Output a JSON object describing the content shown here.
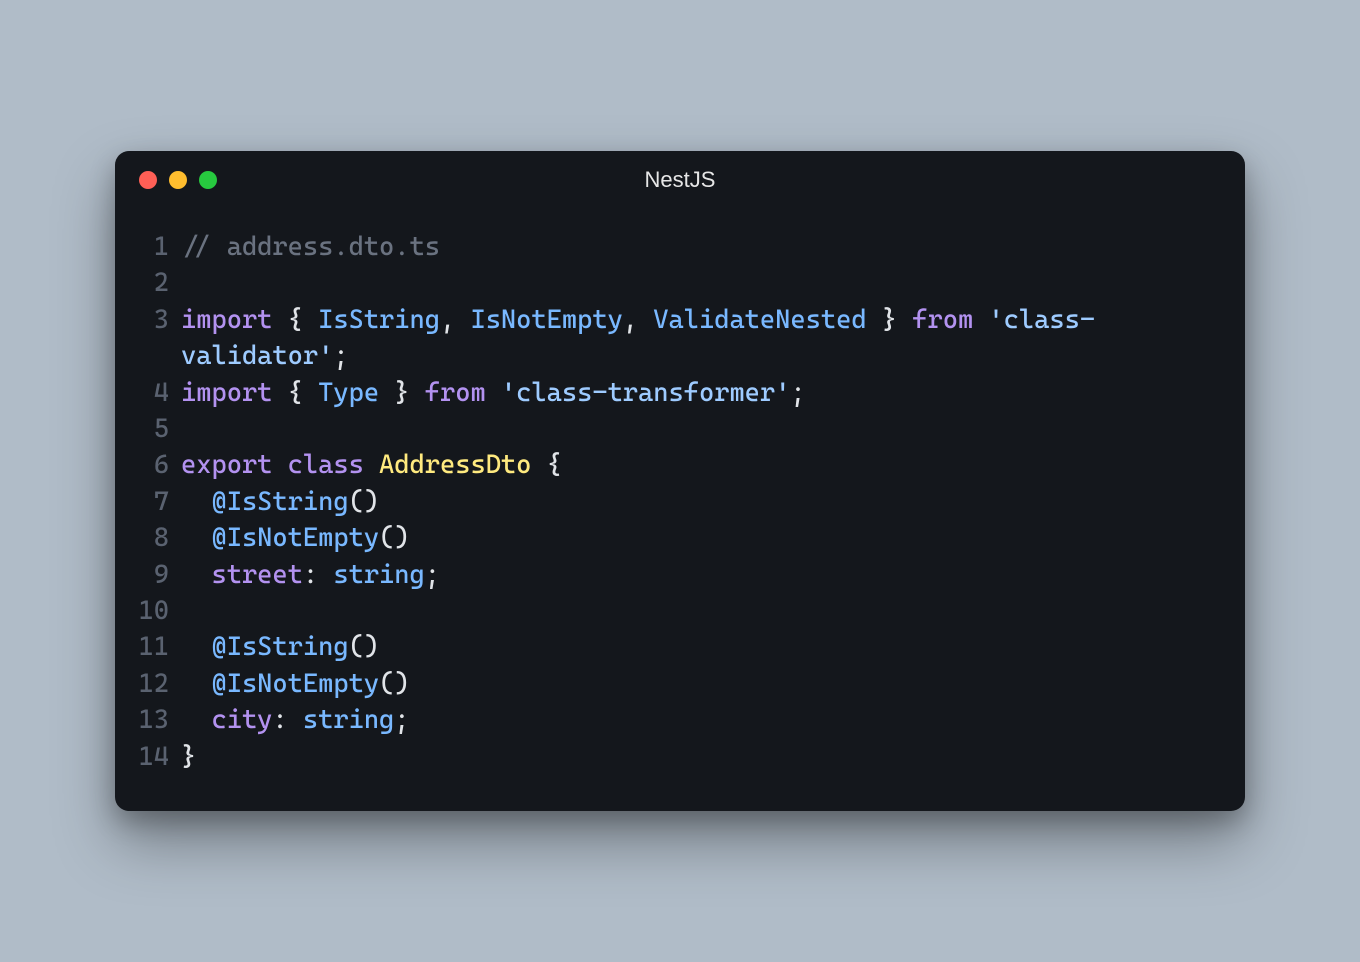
{
  "window": {
    "title": "NestJS",
    "trafficLights": {
      "red": "#ff5f56",
      "yellow": "#ffbd2e",
      "green": "#27c93f"
    }
  },
  "code": {
    "lines": [
      {
        "n": "1",
        "tokens": [
          {
            "t": "// address.dto.ts",
            "c": "tk-comment"
          }
        ]
      },
      {
        "n": "2",
        "tokens": []
      },
      {
        "n": "3",
        "tokens": [
          {
            "t": "import",
            "c": "tk-keyword"
          },
          {
            "t": " { ",
            "c": "tk-punct"
          },
          {
            "t": "IsString",
            "c": "tk-type"
          },
          {
            "t": ", ",
            "c": "tk-punct"
          },
          {
            "t": "IsNotEmpty",
            "c": "tk-type"
          },
          {
            "t": ", ",
            "c": "tk-punct"
          },
          {
            "t": "ValidateNested",
            "c": "tk-type"
          },
          {
            "t": " } ",
            "c": "tk-punct"
          },
          {
            "t": "from",
            "c": "tk-keyword"
          },
          {
            "t": " ",
            "c": "tk-punct"
          },
          {
            "t": "'class-",
            "c": "tk-string"
          }
        ],
        "wrap": [
          {
            "t": "validator'",
            "c": "tk-string"
          },
          {
            "t": ";",
            "c": "tk-punct"
          }
        ]
      },
      {
        "n": "4",
        "tokens": [
          {
            "t": "import",
            "c": "tk-keyword"
          },
          {
            "t": " { ",
            "c": "tk-punct"
          },
          {
            "t": "Type",
            "c": "tk-type"
          },
          {
            "t": " } ",
            "c": "tk-punct"
          },
          {
            "t": "from",
            "c": "tk-keyword"
          },
          {
            "t": " ",
            "c": "tk-punct"
          },
          {
            "t": "'class-transformer'",
            "c": "tk-string"
          },
          {
            "t": ";",
            "c": "tk-punct"
          }
        ]
      },
      {
        "n": "5",
        "tokens": []
      },
      {
        "n": "6",
        "tokens": [
          {
            "t": "export",
            "c": "tk-keyword"
          },
          {
            "t": " ",
            "c": "tk-punct"
          },
          {
            "t": "class",
            "c": "tk-keyword"
          },
          {
            "t": " ",
            "c": "tk-punct"
          },
          {
            "t": "AddressDto",
            "c": "tk-class"
          },
          {
            "t": " {",
            "c": "tk-punct"
          }
        ]
      },
      {
        "n": "7",
        "tokens": [
          {
            "t": "  @",
            "c": "tk-decorator"
          },
          {
            "t": "IsString",
            "c": "tk-decorator"
          },
          {
            "t": "()",
            "c": "tk-punct"
          }
        ]
      },
      {
        "n": "8",
        "tokens": [
          {
            "t": "  @",
            "c": "tk-decorator"
          },
          {
            "t": "IsNotEmpty",
            "c": "tk-decorator"
          },
          {
            "t": "()",
            "c": "tk-punct"
          }
        ]
      },
      {
        "n": "9",
        "tokens": [
          {
            "t": "  ",
            "c": "tk-punct"
          },
          {
            "t": "street",
            "c": "tk-prop"
          },
          {
            "t": ": ",
            "c": "tk-punct"
          },
          {
            "t": "string",
            "c": "tk-type"
          },
          {
            "t": ";",
            "c": "tk-punct"
          }
        ]
      },
      {
        "n": "10",
        "tokens": []
      },
      {
        "n": "11",
        "tokens": [
          {
            "t": "  @",
            "c": "tk-decorator"
          },
          {
            "t": "IsString",
            "c": "tk-decorator"
          },
          {
            "t": "()",
            "c": "tk-punct"
          }
        ]
      },
      {
        "n": "12",
        "tokens": [
          {
            "t": "  @",
            "c": "tk-decorator"
          },
          {
            "t": "IsNotEmpty",
            "c": "tk-decorator"
          },
          {
            "t": "()",
            "c": "tk-punct"
          }
        ]
      },
      {
        "n": "13",
        "tokens": [
          {
            "t": "  ",
            "c": "tk-punct"
          },
          {
            "t": "city",
            "c": "tk-prop"
          },
          {
            "t": ": ",
            "c": "tk-punct"
          },
          {
            "t": "string",
            "c": "tk-type"
          },
          {
            "t": ";",
            "c": "tk-punct"
          }
        ]
      },
      {
        "n": "14",
        "tokens": [
          {
            "t": "}",
            "c": "tk-punct"
          }
        ]
      }
    ]
  }
}
